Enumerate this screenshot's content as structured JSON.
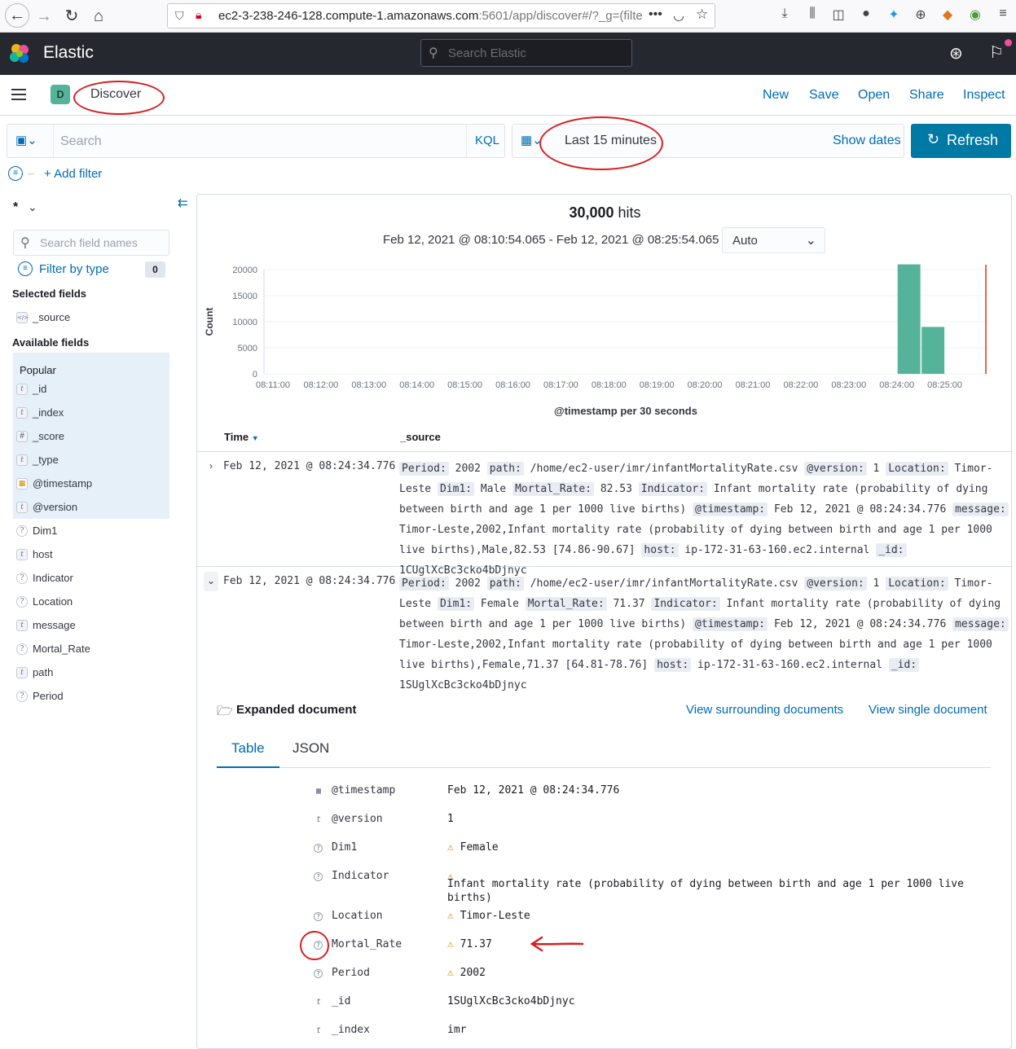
{
  "browser": {
    "url_main": "ec2-3-238-246-128.compute-1.amazonaws.com",
    "url_rest": ":5601/app/discover#/?_g=(filters:!("
  },
  "header": {
    "brand": "Elastic",
    "search_placeholder": "Search Elastic"
  },
  "subheader": {
    "space_initial": "D",
    "breadcrumb": "Discover",
    "links": [
      "New",
      "Save",
      "Open",
      "Share",
      "Inspect"
    ]
  },
  "query": {
    "placeholder": "Search",
    "language": "KQL",
    "date_range": "Last 15 minutes",
    "show_dates": "Show dates",
    "refresh": "Refresh",
    "add_filter": "+ Add filter"
  },
  "sidebar": {
    "index_pattern": "*",
    "field_search_placeholder": "Search field names",
    "filter_by_type": "Filter by type",
    "filter_count": "0",
    "selected_title": "Selected fields",
    "selected": [
      {
        "name": "_source",
        "type": "source"
      }
    ],
    "available_title": "Available fields",
    "popular_title": "Popular",
    "popular": [
      {
        "name": "_id",
        "type": "t"
      },
      {
        "name": "_index",
        "type": "t"
      },
      {
        "name": "_score",
        "type": "#"
      },
      {
        "name": "_type",
        "type": "t"
      },
      {
        "name": "@timestamp",
        "type": "date"
      },
      {
        "name": "@version",
        "type": "t"
      }
    ],
    "others": [
      {
        "name": "Dim1",
        "type": "?"
      },
      {
        "name": "host",
        "type": "t"
      },
      {
        "name": "Indicator",
        "type": "?"
      },
      {
        "name": "Location",
        "type": "?"
      },
      {
        "name": "message",
        "type": "t"
      },
      {
        "name": "Mortal_Rate",
        "type": "?"
      },
      {
        "name": "path",
        "type": "t"
      },
      {
        "name": "Period",
        "type": "?"
      }
    ]
  },
  "results": {
    "hits_count": "30,000",
    "hits_label": "hits",
    "range_text": "Feb 12, 2021 @ 08:10:54.065 - Feb 12, 2021 @ 08:25:54.065",
    "interval": "Auto",
    "col_time": "Time",
    "col_source": "_source",
    "docs": [
      {
        "timestamp": "Feb 12, 2021 @ 08:24:34.776",
        "fields": [
          [
            "Period:",
            "2002"
          ],
          [
            "path:",
            "/home/ec2-user/imr/infantMortalityRate.csv"
          ],
          [
            "@version:",
            "1"
          ],
          [
            "Location:",
            "Timor-Leste"
          ],
          [
            "Dim1:",
            "Male"
          ],
          [
            "Mortal_Rate:",
            "82.53"
          ],
          [
            "Indicator:",
            "Infant mortality rate (probability of dying between birth and age 1 per 1000 live births)"
          ],
          [
            "@timestamp:",
            "Feb 12, 2021 @ 08:24:34.776"
          ],
          [
            "message:",
            "Timor-Leste,2002,Infant mortality rate (probability of dying between birth and age 1 per 1000 live births),Male,82.53 [74.86-90.67]"
          ],
          [
            "host:",
            "ip-172-31-63-160.ec2.internal"
          ],
          [
            "_id:",
            "1CUglXcBc3cko4bDjnyc"
          ]
        ]
      },
      {
        "timestamp": "Feb 12, 2021 @ 08:24:34.776",
        "fields": [
          [
            "Period:",
            "2002"
          ],
          [
            "path:",
            "/home/ec2-user/imr/infantMortalityRate.csv"
          ],
          [
            "@version:",
            "1"
          ],
          [
            "Location:",
            "Timor-Leste"
          ],
          [
            "Dim1:",
            "Female"
          ],
          [
            "Mortal_Rate:",
            "71.37"
          ],
          [
            "Indicator:",
            "Infant mortality rate (probability of dying between birth and age 1 per 1000 live births)"
          ],
          [
            "@timestamp:",
            "Feb 12, 2021 @ 08:24:34.776"
          ],
          [
            "message:",
            "Timor-Leste,2002,Infant mortality rate (probability of dying between birth and age 1 per 1000 live births),Female,71.37 [64.81-78.76]"
          ],
          [
            "host:",
            "ip-172-31-63-160.ec2.internal"
          ],
          [
            "_id:",
            "1SUglXcBc3cko4bDjnyc"
          ]
        ]
      }
    ]
  },
  "expanded": {
    "title": "Expanded document",
    "surrounding": "View surrounding documents",
    "single": "View single document",
    "tab_table": "Table",
    "tab_json": "JSON",
    "rows": [
      {
        "icon": "date",
        "name": "@timestamp",
        "value": "Feb 12, 2021 @ 08:24:34.776",
        "warn": false
      },
      {
        "icon": "t",
        "name": "@version",
        "value": "1",
        "warn": false
      },
      {
        "icon": "?",
        "name": "Dim1",
        "value": "Female",
        "warn": true
      },
      {
        "icon": "?",
        "name": "Indicator",
        "value": "Infant mortality rate (probability of dying between birth and age 1 per 1000 live births)",
        "warn": true
      },
      {
        "icon": "?",
        "name": "Location",
        "value": "Timor-Leste",
        "warn": true
      },
      {
        "icon": "?",
        "name": "Mortal_Rate",
        "value": "71.37",
        "warn": true
      },
      {
        "icon": "?",
        "name": "Period",
        "value": "2002",
        "warn": true
      },
      {
        "icon": "t",
        "name": "_id",
        "value": "1SUglXcBc3cko4bDjnyc",
        "warn": false
      },
      {
        "icon": "t",
        "name": "_index",
        "value": "imr",
        "warn": false
      }
    ]
  },
  "chart_data": {
    "type": "bar",
    "title": "",
    "xlabel": "@timestamp per 30 seconds",
    "ylabel": "Count",
    "categories": [
      "08:11:00",
      "08:12:00",
      "08:13:00",
      "08:14:00",
      "08:15:00",
      "08:16:00",
      "08:17:00",
      "08:18:00",
      "08:19:00",
      "08:20:00",
      "08:21:00",
      "08:22:00",
      "08:23:00",
      "08:24:00",
      "08:25:00"
    ],
    "yticks": [
      "0",
      "5000",
      "10000",
      "15000",
      "20000"
    ],
    "ylim": [
      0,
      20000
    ],
    "bars": [
      {
        "x": "08:24:00",
        "value": 21000
      },
      {
        "x": "08:24:30",
        "value": 9000
      }
    ],
    "bar_color": "#54b399",
    "now_marker_color": "#e7664c"
  }
}
